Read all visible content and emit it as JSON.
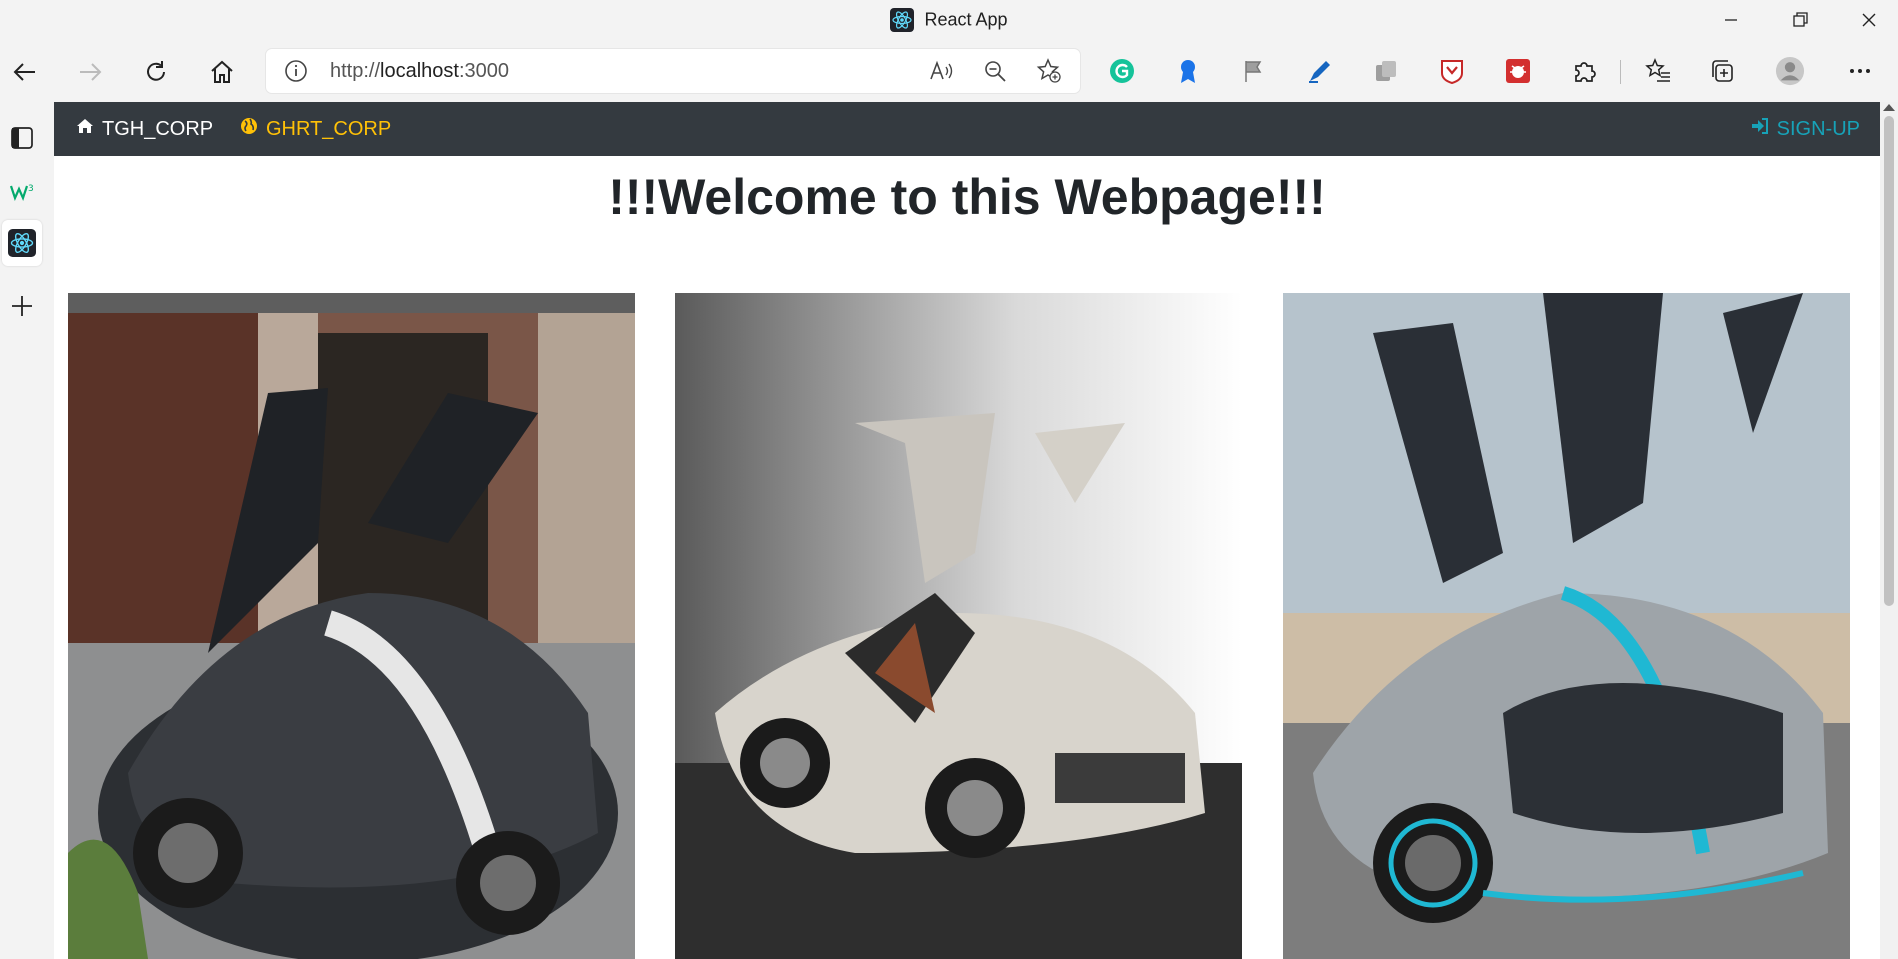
{
  "window": {
    "title": "React App"
  },
  "browser": {
    "url_prefix": "http://",
    "url_host": "localhost",
    "url_port": ":3000"
  },
  "navbar": {
    "brand_label": "TGH_CORP",
    "link_label": "GHRT_CORP",
    "signup_label": "SIGN-UP",
    "colors": {
      "background": "#343a40",
      "link": "#ffc107",
      "signup": "#17a2b8"
    }
  },
  "main": {
    "heading": "!!!Welcome to this Webpage!!!",
    "cards": [
      {
        "image": "black supercar with gullwing doors open in front of garage"
      },
      {
        "image": "silver supercar with gullwing doors open on grey gradient"
      },
      {
        "image": "silver and cyan supercar with gullwing doors open on tarmac"
      }
    ]
  }
}
